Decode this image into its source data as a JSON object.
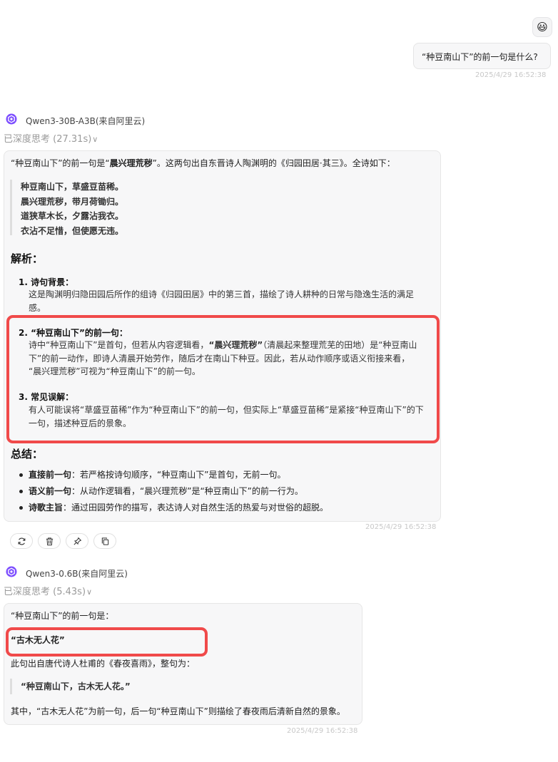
{
  "user": {
    "avatar_icon": "smiley-face-icon",
    "avatar_glyph": "😃",
    "question": "“种豆南山下”的前一句是什么?",
    "timestamp": "2025/4/29 16:52:38"
  },
  "answer1": {
    "model": "Qwen3-30B-A3B(来自阿里云)",
    "think_label": "已深度思考",
    "think_time": "(27.31s)",
    "intro_prefix": "“种豆南山下”的前一句是“",
    "intro_bold": "晨兴理荒秽",
    "intro_suffix": "”。这两句出自东晋诗人陶渊明的《归园田居·其三》。全诗如下：",
    "poem": [
      "种豆南山下，草盛豆苗稀。",
      "晨兴理荒秽，带月荷锄归。",
      "道狭草木长，夕露沾我衣。",
      "衣沾不足惜，但使愿无违。"
    ],
    "analysis_heading": "解析：",
    "item1_title": "1. 诗句背景：",
    "item1_lines": [
      "这是陶渊明归隐田园后所作的组诗《归园田居》中的第三首，描绘了诗人耕种的日常与隐逸生活的满足",
      "感。"
    ],
    "item2_title": "2. “种豆南山下”的前一句：",
    "item2_line1_a": "诗中“种豆南山下”是首句，但若从内容逻辑看，",
    "item2_line1_bold": "“晨兴理荒秽”",
    "item2_line1_b": "（清晨起来整理荒芜的田地）是“种豆南山",
    "item2_line2": "下”的前一动作，即诗人清晨开始劳作，随后才在南山下种豆。因此，若从动作顺序或语义衔接来看，",
    "item2_line3": "“晨兴理荒秽”可视为“种豆南山下”的前一句。",
    "item3_title": "3. 常见误解：",
    "item3_lines": [
      "有人可能误将“草盛豆苗稀”作为“种豆南山下”的前一句，但实际上“草盛豆苗稀”是紧接“种豆南山下”的下",
      "一句，描述种豆后的景象。"
    ],
    "summary_heading": "总结：",
    "bullets": [
      {
        "label": "直接前一句",
        "text": "：若严格按诗句顺序，“种豆南山下”是首句，无前一句。"
      },
      {
        "label": "语义前一句",
        "text": "：从动作逻辑看，“晨兴理荒秽”是“种豆南山下”的前一行为。"
      },
      {
        "label": "诗歌主旨",
        "text": "：通过田园劳作的描写，表达诗人对自然生活的热爱与对世俗的超脱。"
      }
    ],
    "timestamp": "2025/4/29 16:52:38",
    "actions": [
      "refresh-icon",
      "trash-icon",
      "pin-icon",
      "copy-icon"
    ]
  },
  "answer2": {
    "model": "Qwen3-0.6B(来自阿里云)",
    "think_label": "已深度思考",
    "think_time": "(5.43s)",
    "intro": "“种豆南山下”的前一句是：",
    "answer_bold": "“古木无人花”",
    "source_line": "此句出自唐代诗人杜甫的《春夜喜雨》，整句为：",
    "quote_line": "“种豆南山下，古木无人花。”",
    "closing": "其中，“古木无人花”为前一句，后一句“种豆南山下”则描绘了春夜雨后清新自然的景象。",
    "timestamp": "2025/4/29 16:52:38"
  },
  "colors": {
    "highlight": "#f04a4a",
    "logo": "#7c4dff"
  }
}
